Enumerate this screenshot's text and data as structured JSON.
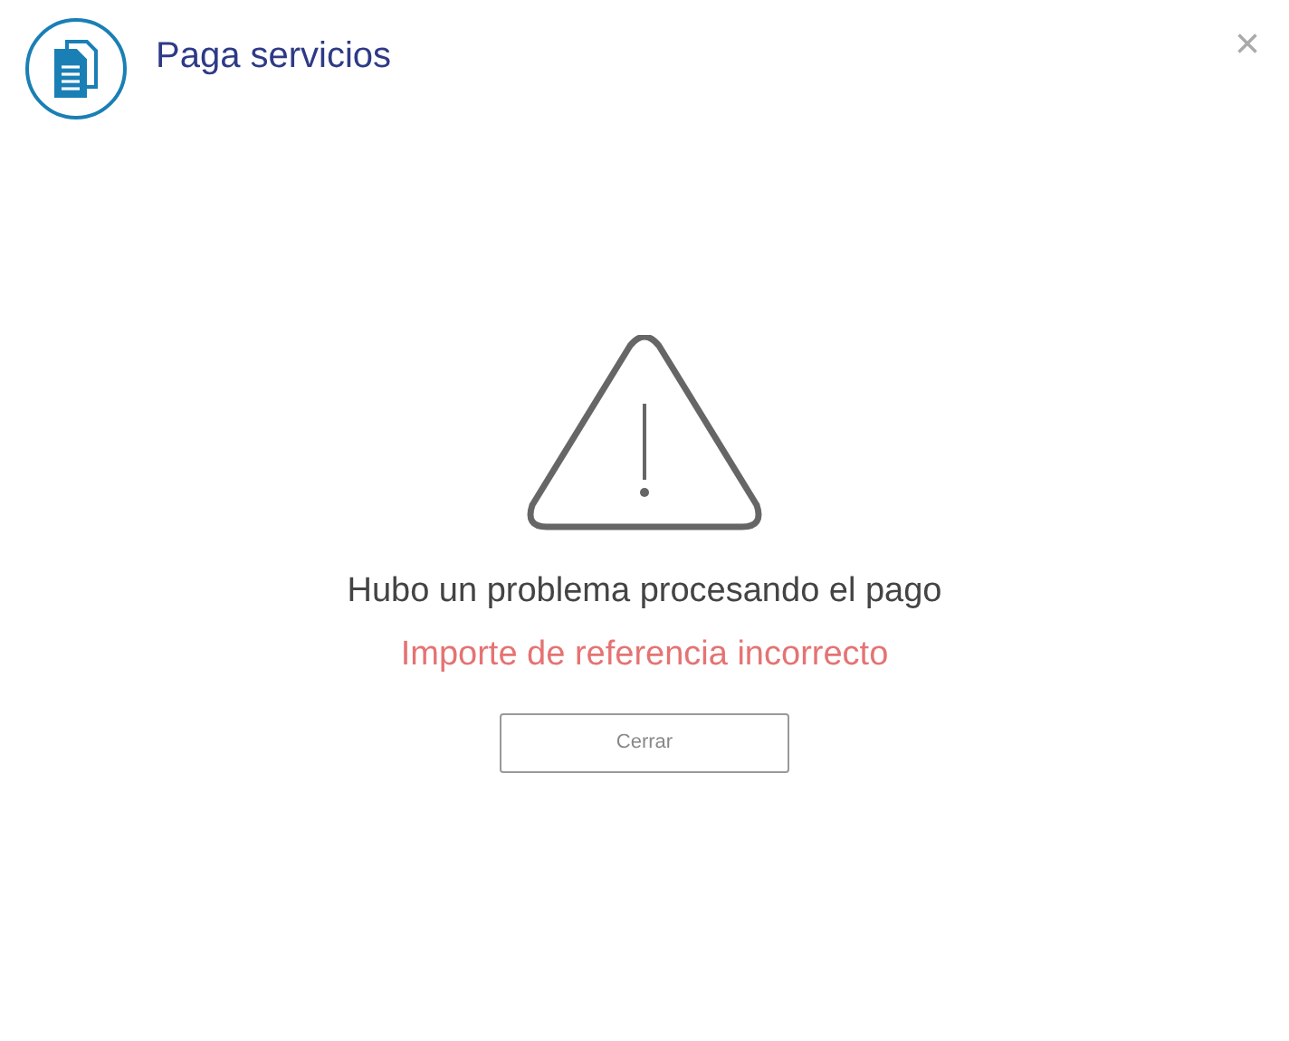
{
  "header": {
    "title": "Paga servicios",
    "close": "×"
  },
  "message": {
    "title": "Hubo un problema procesando el pago",
    "detail": "Importe de referencia incorrecto"
  },
  "buttons": [
    "Cerrar"
  ]
}
